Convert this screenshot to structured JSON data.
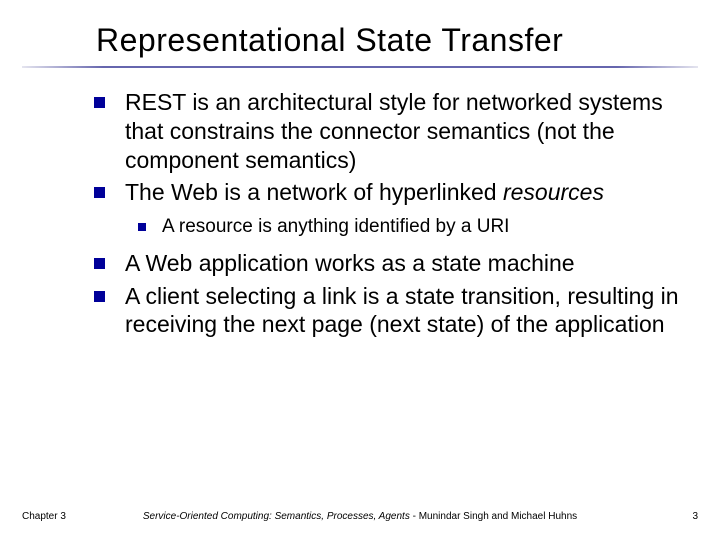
{
  "slide": {
    "title": "Representational State Transfer",
    "bullets_l1": [
      {
        "text": "REST is an architectural style for networked systems that constrains the connector semantics (not the component semantics)"
      },
      {
        "text_pre": "The Web is a network of hyperlinked ",
        "text_italic": "resources"
      }
    ],
    "bullets_l2": [
      {
        "text": "A resource is anything identified by a URI"
      }
    ],
    "bullets_l1b": [
      {
        "text": "A Web application works as a state machine"
      },
      {
        "text": "A client selecting a link is a state transition, resulting in receiving the next page (next state) of the application"
      }
    ],
    "footer": {
      "left": "Chapter 3",
      "center_italic": "Service-Oriented Computing: Semantics, Processes, Agents",
      "center_rest": " - Munindar Singh and Michael Huhns",
      "right": "3"
    }
  },
  "colors": {
    "bullet": "#000099"
  }
}
